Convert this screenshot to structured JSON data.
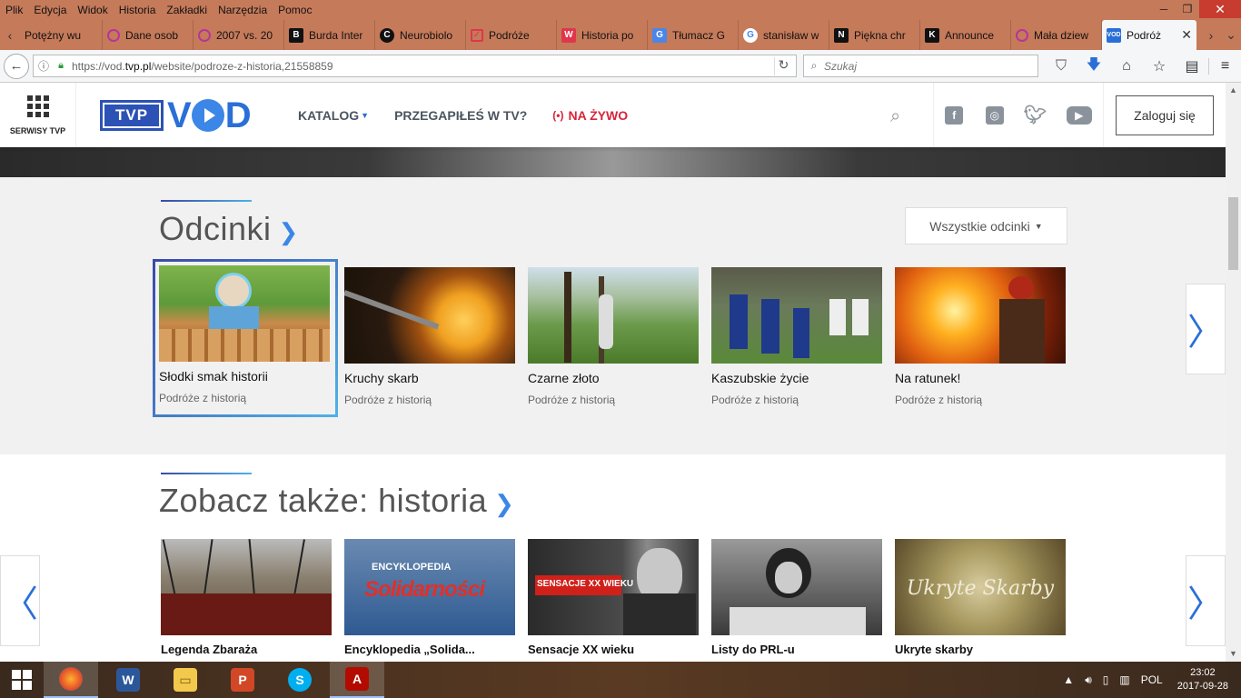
{
  "menubar": {
    "items": [
      "Plik",
      "Edycja",
      "Widok",
      "Historia",
      "Zakładki",
      "Narzędzia",
      "Pomoc"
    ]
  },
  "window_controls": {
    "minimize": "─",
    "restore": "❐",
    "close": "✕"
  },
  "tabs": [
    {
      "label": "Potężny wu",
      "icon": "nav-icon",
      "color": "#c57a5a"
    },
    {
      "label": "Dane osob",
      "icon": "ring-icon",
      "color": "#b6359a"
    },
    {
      "label": "2007 vs. 20",
      "icon": "ring-icon",
      "color": "#b6359a"
    },
    {
      "label": "Burda Inter",
      "icon": "b-logo-icon",
      "color": "#111111"
    },
    {
      "label": "Neurobiolo",
      "icon": "c-logo-icon",
      "color": "#111111"
    },
    {
      "label": "Podróże",
      "icon": "pocket-icon",
      "color": "#e0364b"
    },
    {
      "label": "Historia po",
      "icon": "w-logo-icon",
      "color": "#e0364b"
    },
    {
      "label": "Tłumacz G",
      "icon": "translate-icon",
      "color": "#4a86e8"
    },
    {
      "label": "stanisław w",
      "icon": "google-icon",
      "color": "#ffffff"
    },
    {
      "label": "Piękna chr",
      "icon": "n-logo-icon",
      "color": "#111111"
    },
    {
      "label": "Announce",
      "icon": "k-logo-icon",
      "color": "#111111"
    },
    {
      "label": "Mała dziew",
      "icon": "ring-icon",
      "color": "#b6359a"
    },
    {
      "label": "Podróż",
      "icon": "vod-icon",
      "color": "#2a6fd8",
      "active": true
    }
  ],
  "urlbar": {
    "url_prefix": "https://vod.",
    "url_domain": "tvp.pl",
    "url_path": "/website/podroze-z-historia,21558859"
  },
  "searchbar": {
    "placeholder": "Szukaj"
  },
  "site": {
    "serwisy_label": "SERWISY TVP",
    "logo_tvp": "TVP",
    "nav": {
      "katalog": "KATALOG",
      "przegapiles": "PRZEGAPIŁEŚ W TV?",
      "na_zywo": "NA ŻYWO"
    },
    "login_label": "Zaloguj się"
  },
  "episodes": {
    "title": "Odcinki",
    "dropdown_label": "Wszystkie odcinki",
    "items": [
      {
        "title": "Słodki smak historii",
        "subtitle": "Podróże z historią"
      },
      {
        "title": "Kruchy skarb",
        "subtitle": "Podróże z historią"
      },
      {
        "title": "Czarne złoto",
        "subtitle": "Podróże z historią"
      },
      {
        "title": "Kaszubskie życie",
        "subtitle": "Podróże z historią"
      },
      {
        "title": "Na ratunek!",
        "subtitle": "Podróże z historią"
      }
    ]
  },
  "see_also": {
    "title": "Zobacz także: historia",
    "items": [
      {
        "title": "Legenda Zbaraża"
      },
      {
        "title": "Encyklopedia „Solida..."
      },
      {
        "title": "Sensacje XX wieku"
      },
      {
        "title": "Listy do PRL-u"
      },
      {
        "title": "Ukryte skarby"
      }
    ],
    "thumb_texts": {
      "encyklopedia_top": "ENCYKLOPEDIA",
      "encyklopedia_main": "Solidarności",
      "sensacje": "SENSACJE XX WIEKU",
      "ukryte": "Ukryte Skarby"
    }
  },
  "taskbar": {
    "apps": [
      "firefox",
      "word",
      "file-explorer",
      "powerpoint",
      "skype",
      "acrobat"
    ],
    "language": "POL",
    "time": "23:02",
    "date": "2017-09-28"
  }
}
